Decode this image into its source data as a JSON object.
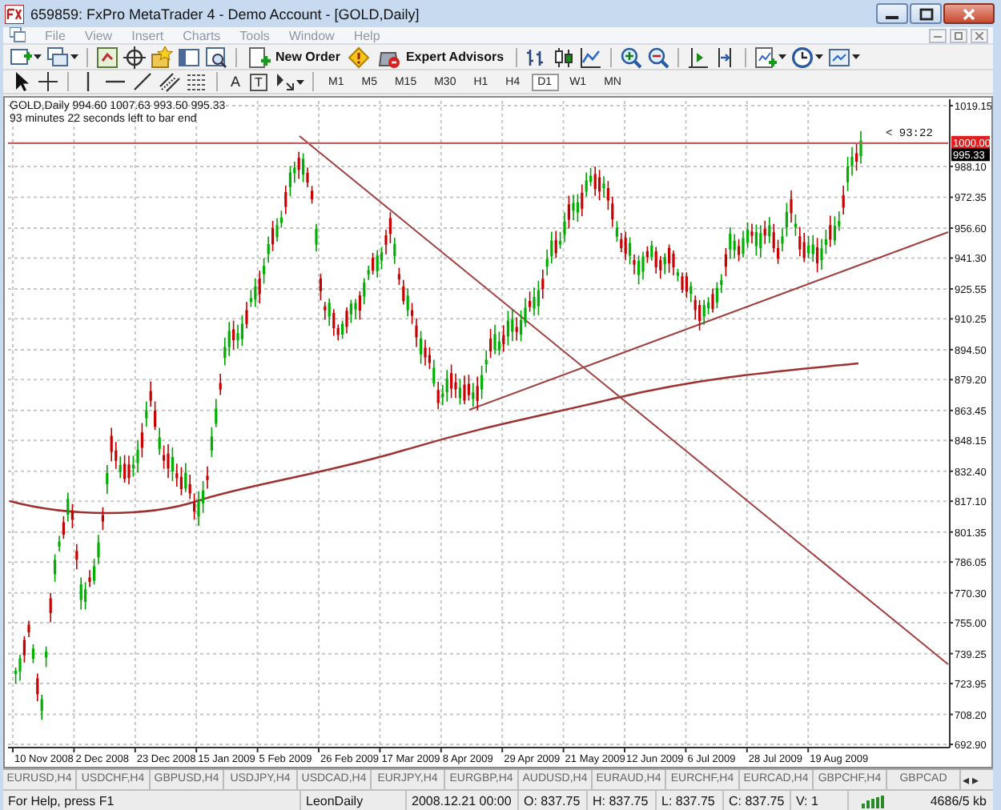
{
  "window": {
    "title": "659859: FxPro MetaTrader 4 - Demo Account - [GOLD,Daily]"
  },
  "menu": [
    "File",
    "View",
    "Insert",
    "Charts",
    "Tools",
    "Window",
    "Help"
  ],
  "toolbar": {
    "new_order": "New Order",
    "expert_advisors": "Expert Advisors"
  },
  "drawing_tools": [
    {
      "kind": "cursor"
    },
    {
      "kind": "crosshair"
    },
    {
      "kind": "vline"
    },
    {
      "kind": "hline"
    },
    {
      "kind": "trendline"
    },
    {
      "kind": "channel"
    },
    {
      "kind": "fibo"
    },
    {
      "kind": "text",
      "label": "A"
    },
    {
      "kind": "label",
      "label": "T"
    },
    {
      "kind": "arrows"
    }
  ],
  "timeframes": [
    {
      "label": "M1",
      "selected": false
    },
    {
      "label": "M5",
      "selected": false
    },
    {
      "label": "M15",
      "selected": false
    },
    {
      "label": "M30",
      "selected": false
    },
    {
      "label": "H1",
      "selected": false
    },
    {
      "label": "H4",
      "selected": false
    },
    {
      "label": "D1",
      "selected": true
    },
    {
      "label": "W1",
      "selected": false
    },
    {
      "label": "MN",
      "selected": false
    }
  ],
  "chart": {
    "info": "GOLD,Daily  994.60 1007.63 993.50 995.33",
    "countdown": "93 minutes 22 seconds left to bar end",
    "timer": "< 93:22",
    "price_labels": [
      {
        "kind": "alert",
        "text": "1000.00"
      },
      {
        "kind": "bid",
        "text": "995.33"
      }
    ],
    "y_ticks": [
      "1019.15",
      "988.10",
      "972.35",
      "956.60",
      "941.30",
      "925.55",
      "910.25",
      "894.50",
      "879.20",
      "863.45",
      "848.15",
      "832.40",
      "817.10",
      "801.35",
      "786.05",
      "770.30",
      "755.00",
      "739.25",
      "723.95",
      "708.20",
      "692.90"
    ],
    "x_ticks": [
      "10 Nov 2008",
      "2 Dec 2008",
      "23 Dec 2008",
      "15 Jan 2009",
      "5 Feb 2009",
      "26 Feb 2009",
      "17 Mar 2009",
      "8 Apr 2009",
      "29 Apr 2009",
      "21 May 2009",
      "12 Jun 2009",
      "6 Jul 2009",
      "28 Jul 2009",
      "19 Aug 2009"
    ]
  },
  "symbol_tabs": [
    "EURUSD,H4",
    "USDCHF,H4",
    "GBPUSD,H4",
    "USDJPY,H4",
    "USDCAD,H4",
    "EURJPY,H4",
    "EURGBP,H4",
    "AUDUSD,H4",
    "EURAUD,H4",
    "EURCHF,H4",
    "EURCAD,H4",
    "GBPCHF,H4",
    "GBPCAD"
  ],
  "tab_scroll": [
    "◂",
    "▸"
  ],
  "status_bar": {
    "help": "For Help, press F1",
    "profile": "LeonDaily",
    "time": "2008.12.21 00:00",
    "open": "O: 837.75",
    "high": "H: 837.75",
    "low": "L: 837.75",
    "close": "C: 837.75",
    "volume": "V: 1",
    "traffic": "4686/5 kb"
  }
}
